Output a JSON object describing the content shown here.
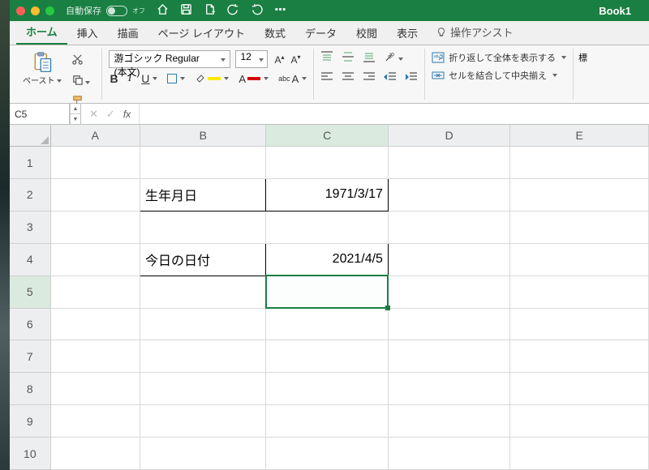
{
  "title_bar": {
    "autosave_label": "自動保存",
    "autosave_state": "オフ",
    "book_title": "Book1"
  },
  "tabs": {
    "items": [
      "ホーム",
      "挿入",
      "描画",
      "ページ レイアウト",
      "数式",
      "データ",
      "校閲",
      "表示"
    ],
    "active": 0,
    "tell_me": "操作アシスト"
  },
  "ribbon": {
    "paste": "ペースト",
    "font_name": "游ゴシック Regular (本文)",
    "font_size": "12",
    "bold": "B",
    "italic": "I",
    "underline": "U",
    "wrap_text": "折り返して全体を表示する",
    "merge_center": "セルを結合して中央揃え",
    "std_label": "標"
  },
  "name_box": {
    "ref": "C5",
    "fx": "fx"
  },
  "grid": {
    "columns": [
      "A",
      "B",
      "C",
      "D",
      "E"
    ],
    "rows": [
      "1",
      "2",
      "3",
      "4",
      "5",
      "6",
      "7",
      "8",
      "9",
      "10"
    ],
    "cells": {
      "B2": "生年月日",
      "C2": "1971/3/17",
      "B4": "今日の日付",
      "C4": "2021/4/5"
    },
    "selected": "C5"
  }
}
